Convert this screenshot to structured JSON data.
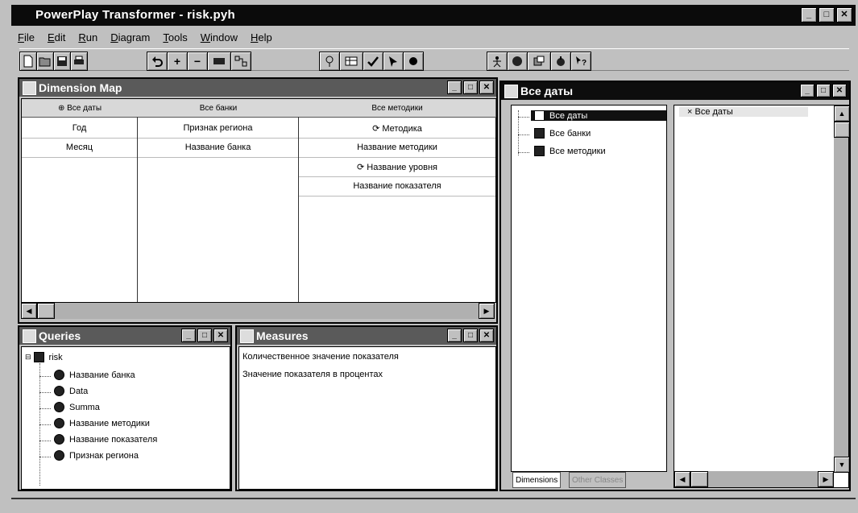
{
  "app": {
    "title": "PowerPlay Transformer - risk.pyh"
  },
  "menu": [
    "File",
    "Edit",
    "Run",
    "Diagram",
    "Tools",
    "Window",
    "Help"
  ],
  "window_controls": {
    "minimize": "_",
    "maximize": "□",
    "close": "✕"
  },
  "dimension_map": {
    "title": "Dimension Map",
    "columns": [
      {
        "header": "⊕ Все даты",
        "cells": [
          "Год",
          "Месяц"
        ]
      },
      {
        "header": "Все банки",
        "cells": [
          "Признак региона",
          "Название банка"
        ]
      },
      {
        "header": "Все методики",
        "cells": [
          "⟳ Методика",
          "Название методики",
          "⟳ Название уровня",
          "Название показателя"
        ]
      }
    ]
  },
  "queries": {
    "title": "Queries",
    "root": "risk",
    "items": [
      "Название банка",
      "Data",
      "Summa",
      "Название методики",
      "Название показателя",
      "Признак региона"
    ]
  },
  "measures": {
    "title": "Measures",
    "items": [
      "Количественное значение показателя",
      "Значение показателя в процентах"
    ]
  },
  "dates_window": {
    "title": "Все даты",
    "tree": [
      "Все даты",
      "Все банки",
      "Все методики"
    ],
    "right_item": "× Все даты",
    "tabs": [
      "Dimensions",
      "Other Classes"
    ]
  }
}
